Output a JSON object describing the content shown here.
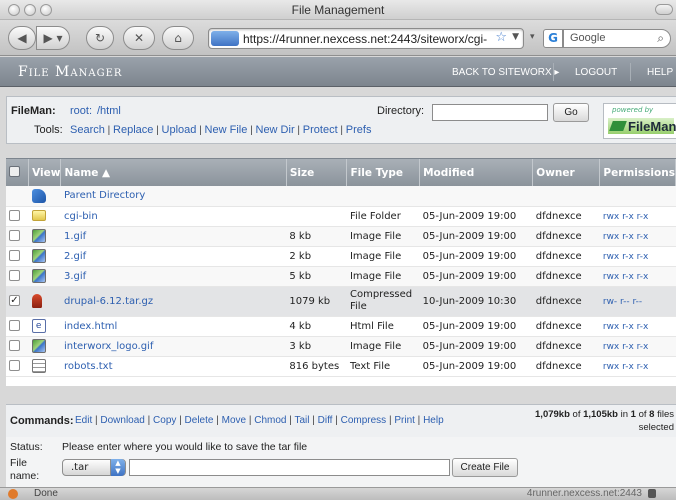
{
  "window": {
    "title": "File Management"
  },
  "browser": {
    "url": "https://4runner.nexcess.net:2443/siteworx/cgi-",
    "search_engine": "G",
    "search_placeholder": "Google",
    "status_text": "Done",
    "status_host": "4runner.nexcess.net:2443"
  },
  "app": {
    "title": "File Manager",
    "nav": {
      "back": "BACK TO SITEWORX ▸",
      "logout": "LOGOUT",
      "help": "HELP"
    }
  },
  "fileman": {
    "label": "FileMan:",
    "path_root": "root:",
    "path_dir": "/html",
    "directory_label": "Directory:",
    "directory_value": "",
    "go_label": "Go",
    "tools_label": "Tools:",
    "tools": [
      "Search",
      "Replace",
      "Upload",
      "New File",
      "New Dir",
      "Protect",
      "Prefs"
    ],
    "powered_by": "powered by",
    "brand": "FileMan"
  },
  "table": {
    "headers": {
      "view": "View",
      "name": "Name ▲",
      "size": "Size",
      "type": "File Type",
      "modified": "Modified",
      "owner": "Owner",
      "permissions": "Permissions"
    },
    "parent": "Parent Directory",
    "rows": [
      {
        "name": "cgi-bin",
        "size": "",
        "type": "File Folder",
        "modified": "05-Jun-2009 19:00",
        "owner": "dfdnexce",
        "perms": "rwx r-x r-x",
        "checked": ""
      },
      {
        "name": "1.gif",
        "size": "8 kb",
        "type": "Image File",
        "modified": "05-Jun-2009 19:00",
        "owner": "dfdnexce",
        "perms": "rwx r-x r-x",
        "checked": ""
      },
      {
        "name": "2.gif",
        "size": "2 kb",
        "type": "Image File",
        "modified": "05-Jun-2009 19:00",
        "owner": "dfdnexce",
        "perms": "rwx r-x r-x",
        "checked": ""
      },
      {
        "name": "3.gif",
        "size": "5 kb",
        "type": "Image File",
        "modified": "05-Jun-2009 19:00",
        "owner": "dfdnexce",
        "perms": "rwx r-x r-x",
        "checked": ""
      },
      {
        "name": "drupal-6.12.tar.gz",
        "size": "1079 kb",
        "type": "Compressed File",
        "modified": "10-Jun-2009 10:30",
        "owner": "dfdnexce",
        "perms": "rw- r-- r--",
        "checked": "✓"
      },
      {
        "name": "index.html",
        "size": "4 kb",
        "type": "Html File",
        "modified": "05-Jun-2009 19:00",
        "owner": "dfdnexce",
        "perms": "rwx r-x r-x",
        "checked": ""
      },
      {
        "name": "interworx_logo.gif",
        "size": "3 kb",
        "type": "Image File",
        "modified": "05-Jun-2009 19:00",
        "owner": "dfdnexce",
        "perms": "rwx r-x r-x",
        "checked": ""
      },
      {
        "name": "robots.txt",
        "size": "816 bytes",
        "type": "Text File",
        "modified": "05-Jun-2009 19:00",
        "owner": "dfdnexce",
        "perms": "rwx r-x r-x",
        "checked": ""
      }
    ]
  },
  "commands": {
    "label": "Commands:",
    "items": [
      "Edit",
      "Download",
      "Copy",
      "Delete",
      "Move",
      "Chmod",
      "Tail",
      "Diff",
      "Compress",
      "Print",
      "Help"
    ],
    "summary_size": "1,079kb",
    "summary_of": " of ",
    "summary_total": "1,105kb",
    "summary_in": " in ",
    "summary_count": "1",
    "summary_of2": " of ",
    "summary_files": "8",
    "summary_tail": " files",
    "summary_selected": "selected"
  },
  "status": {
    "label": "Status:",
    "message": "Please enter where you would like to save the tar file",
    "file_label_1": "File",
    "file_label_2": "name:",
    "ext_value": ".tar",
    "filename_value": "",
    "create_label": "Create File"
  }
}
